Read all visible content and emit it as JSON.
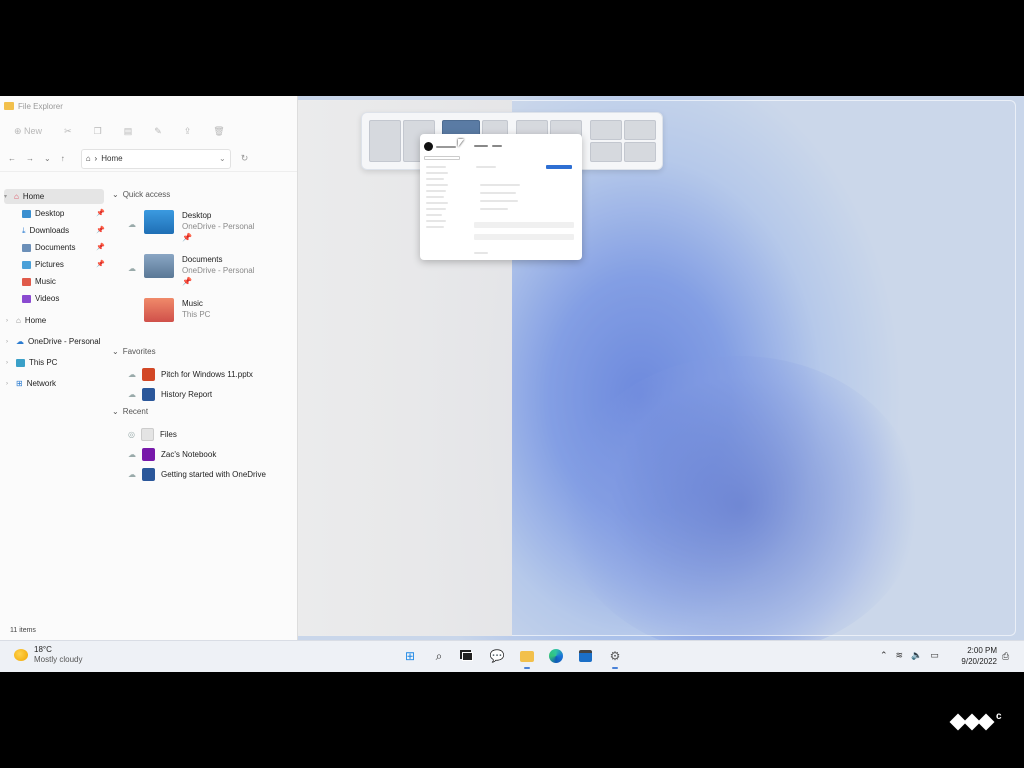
{
  "explorer": {
    "window_title": "File Explorer",
    "new_label": "New",
    "address": "Home",
    "status": "11 items"
  },
  "nav": {
    "items": [
      {
        "label": "Home",
        "selected": true
      },
      {
        "label": "Desktop",
        "pinned": true
      },
      {
        "label": "Downloads",
        "pinned": true
      },
      {
        "label": "Documents",
        "pinned": true
      },
      {
        "label": "Pictures",
        "pinned": true
      },
      {
        "label": "Music"
      },
      {
        "label": "Videos"
      },
      {
        "label": "Home"
      },
      {
        "label": "OneDrive - Personal"
      },
      {
        "label": "This PC"
      },
      {
        "label": "Network"
      }
    ]
  },
  "content": {
    "quick_access_header": "Quick access",
    "quick_access": [
      {
        "name": "Desktop",
        "location": "OneDrive - Personal"
      },
      {
        "name": "Documents",
        "location": "OneDrive - Personal"
      },
      {
        "name": "Music",
        "location": "This PC"
      }
    ],
    "favorites_header": "Favorites",
    "favorites": [
      "Pitch for Windows 11.pptx",
      "History Report"
    ],
    "recent_header": "Recent",
    "recent": [
      "Files",
      "Zac's Notebook",
      "Getting started with OneDrive"
    ]
  },
  "taskbar": {
    "weather_temp": "18°C",
    "weather_desc": "Mostly cloudy",
    "time": "2:00 PM",
    "date": "9/20/2022",
    "icons": [
      "windows-start-icon",
      "search-icon",
      "task-view-icon",
      "chat-icon",
      "file-explorer-icon",
      "edge-icon",
      "store-icon",
      "settings-icon"
    ]
  },
  "colors": {
    "snap_highlight": "#5a7ba4",
    "wallpaper_blue": "#3a5fd6",
    "taskbar_bg": "#eef1f6"
  }
}
